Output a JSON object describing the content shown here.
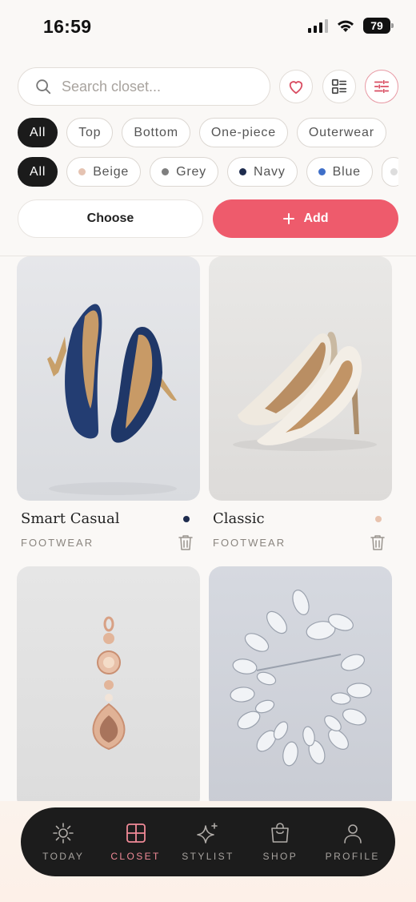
{
  "status_bar": {
    "time": "16:59",
    "battery": "79"
  },
  "search": {
    "placeholder": "Search closet..."
  },
  "category_chips": [
    "All",
    "Top",
    "Bottom",
    "One-piece",
    "Outerwear"
  ],
  "color_chips": [
    {
      "label": "All",
      "dot": ""
    },
    {
      "label": "Beige",
      "dot": "#e5c3b2"
    },
    {
      "label": "Grey",
      "dot": "#7f7f7f"
    },
    {
      "label": "Navy",
      "dot": "#1e2c4e"
    },
    {
      "label": "Blue",
      "dot": "#3f6fc8"
    }
  ],
  "actions": {
    "choose": "Choose",
    "add": "Add"
  },
  "items": [
    {
      "name": "Smart Casual",
      "category": "FOOTWEAR",
      "color": "#1e2c4e"
    },
    {
      "name": "Classic",
      "category": "FOOTWEAR",
      "color": "#e8c3ae"
    }
  ],
  "nav": {
    "today": "TODAY",
    "closet": "CLOSET",
    "stylist": "STYLIST",
    "shop": "SHOP",
    "profile": "PROFILE"
  },
  "colors": {
    "accent": "#ee5b6c",
    "nav_active": "#f08a97",
    "nav_bg": "#1c1c1c"
  }
}
